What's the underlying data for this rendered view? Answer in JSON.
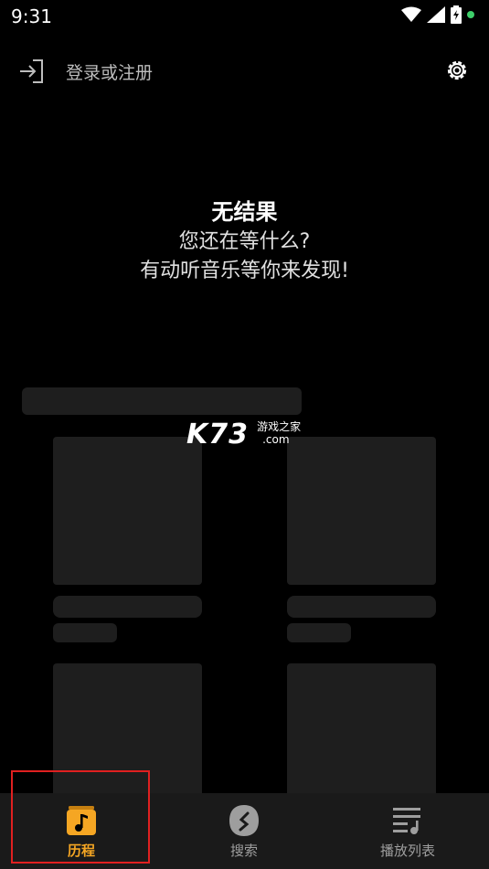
{
  "status_bar": {
    "time": "9:31"
  },
  "header": {
    "login_label": "登录或注册",
    "icons": {
      "login": "login-icon",
      "settings": "gear-icon"
    }
  },
  "empty_state": {
    "title": "无结果",
    "line1": "您还在等什么?",
    "line2": "有动听音乐等你来发现!"
  },
  "watermark": {
    "brand": "K73",
    "sub": "游戏之家",
    "domain": ".com"
  },
  "tabs": [
    {
      "label": "历程",
      "icon": "music-note-icon",
      "active": true
    },
    {
      "label": "搜索",
      "icon": "shazam-s-icon",
      "active": false
    },
    {
      "label": "播放列表",
      "icon": "playlist-icon",
      "active": false
    }
  ],
  "colors": {
    "background": "#000000",
    "accent": "#f5a623",
    "skeleton": "#1e1e1e",
    "tabbar": "#1a1a1a",
    "highlight": "#e02020"
  }
}
